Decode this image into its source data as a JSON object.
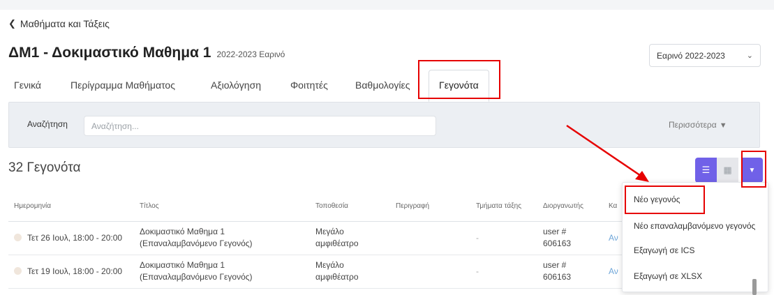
{
  "back_link": "Μαθήματα και Τάξεις",
  "course": {
    "title": "ΔΜ1 - Δοκιμαστικό Μαθημα 1",
    "term": "2022-2023 Εαρινό"
  },
  "semester_select": "Εαρινό 2022-2023",
  "tabs": [
    "Γενικά",
    "Περίγραμμα Μαθήματος",
    "Αξιολόγηση",
    "Φοιτητές",
    "Βαθμολογίες",
    "Γεγονότα"
  ],
  "filter": {
    "label": "Αναζήτηση",
    "placeholder": "Αναζήτηση...",
    "more": "Περισσότερα"
  },
  "events_count": "32 Γεγονότα",
  "table": {
    "headers": [
      "Ημερομηνία",
      "Τίτλος",
      "Τοποθεσία",
      "Περιγραφή",
      "Τμήματα τάξης",
      "Διοργανωτής",
      "Κα"
    ],
    "rows": [
      {
        "date": "Τετ 26 Ιουλ, 18:00 - 20:00",
        "title_line1": "Δοκιμαστικό Μαθημα 1",
        "title_line2": "(Επαναλαμβανόμενο Γεγονός)",
        "location_line1": "Μεγάλο",
        "location_line2": "αμφιθέατρο",
        "description": "",
        "sections": "-",
        "organizer_line1": "user #",
        "organizer_line2": "606163",
        "extra": "Αν"
      },
      {
        "date": "Τετ 19 Ιουλ, 18:00 - 20:00",
        "title_line1": "Δοκιμαστικό Μαθημα 1",
        "title_line2": "(Επαναλαμβανόμενο Γεγονός)",
        "location_line1": "Μεγάλο",
        "location_line2": "αμφιθέατρο",
        "description": "",
        "sections": "-",
        "organizer_line1": "user #",
        "organizer_line2": "606163",
        "extra": "Αν"
      }
    ]
  },
  "dropdown_menu": [
    "Νέο γεγονός",
    "Νέο επαναλαμβανόμενο γεγονός",
    "Εξαγωγή σε ICS",
    "Εξαγωγή σε XLSX"
  ],
  "view_buttons": {
    "list": "list-icon",
    "calendar": "calendar-icon",
    "dropdown": "caret-down-icon"
  },
  "colors": {
    "accent": "#7061e8",
    "highlight": "#e60000",
    "panel": "#eceff3"
  }
}
